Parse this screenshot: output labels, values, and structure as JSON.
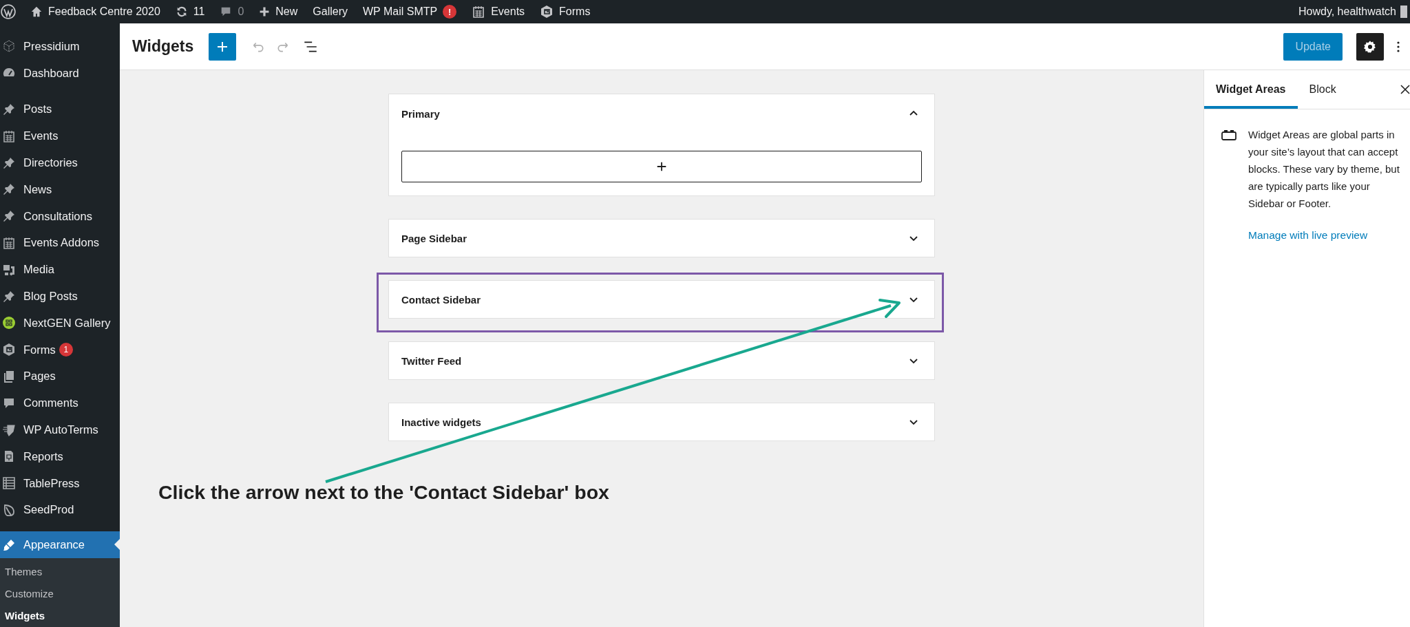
{
  "admin_bar": {
    "items": [
      {
        "kind": "home",
        "label": "Feedback Centre 2020"
      },
      {
        "kind": "updates",
        "label": "11"
      },
      {
        "kind": "comments",
        "label": "0"
      },
      {
        "kind": "new",
        "label": "New"
      },
      {
        "kind": "plain",
        "label": "Gallery"
      },
      {
        "kind": "alert",
        "label": "WP Mail SMTP",
        "badge": "!"
      },
      {
        "kind": "calendar",
        "label": "Events"
      },
      {
        "kind": "forms",
        "label": "Forms"
      }
    ],
    "greeting": "Howdy, healthwatch"
  },
  "sidebar": {
    "items": [
      {
        "kind": "cube",
        "label": "Pressidium",
        "selected": false
      },
      {
        "kind": "gauge",
        "label": "Dashboard",
        "selected": false
      },
      {
        "kind": "pin",
        "label": "Posts",
        "selected": false
      },
      {
        "kind": "calendar",
        "label": "Events",
        "selected": false
      },
      {
        "kind": "pin",
        "label": "Directories",
        "selected": false
      },
      {
        "kind": "pin",
        "label": "News",
        "selected": false
      },
      {
        "kind": "pin",
        "label": "Consultations",
        "selected": false
      },
      {
        "kind": "calendar",
        "label": "Events Addons",
        "selected": false
      },
      {
        "kind": "media",
        "label": "Media",
        "selected": false
      },
      {
        "kind": "pin",
        "label": "Blog Posts",
        "selected": false
      },
      {
        "kind": "gallery",
        "label": "NextGEN Gallery",
        "selected": false
      },
      {
        "kind": "forms",
        "label": "Forms",
        "badge": "1",
        "selected": false
      },
      {
        "kind": "pages",
        "label": "Pages",
        "selected": false
      },
      {
        "kind": "comment",
        "label": "Comments",
        "selected": false
      },
      {
        "kind": "shield",
        "label": "WP AutoTerms",
        "selected": false
      },
      {
        "kind": "report",
        "label": "Reports",
        "selected": false
      },
      {
        "kind": "table",
        "label": "TablePress",
        "selected": false
      },
      {
        "kind": "leaf",
        "label": "SeedProd",
        "selected": false
      },
      {
        "kind": "brush",
        "label": "Appearance",
        "selected": true
      }
    ],
    "submenu": [
      {
        "label": "Themes",
        "selected": false
      },
      {
        "label": "Customize",
        "selected": false
      },
      {
        "label": "Widgets",
        "selected": true
      }
    ]
  },
  "editor": {
    "title": "Widgets",
    "update_label": "Update"
  },
  "areas": [
    {
      "title": "Primary",
      "expanded": true,
      "highlighted": false
    },
    {
      "title": "Page Sidebar",
      "expanded": false,
      "highlighted": false
    },
    {
      "title": "Contact Sidebar",
      "expanded": false,
      "highlighted": true
    },
    {
      "title": "Twitter Feed",
      "expanded": false,
      "highlighted": false
    },
    {
      "title": "Inactive widgets",
      "expanded": false,
      "highlighted": false
    }
  ],
  "panel": {
    "tabs": [
      {
        "label": "Widget Areas",
        "selected": true
      },
      {
        "label": "Block",
        "selected": false
      }
    ],
    "description": "Widget Areas are global parts in your site’s layout that can accept blocks. These vary by theme, but are typically parts like your Sidebar or Footer.",
    "link": "Manage with live preview"
  },
  "annotation": {
    "text": "Click the arrow next to the 'Contact Sidebar' box"
  }
}
